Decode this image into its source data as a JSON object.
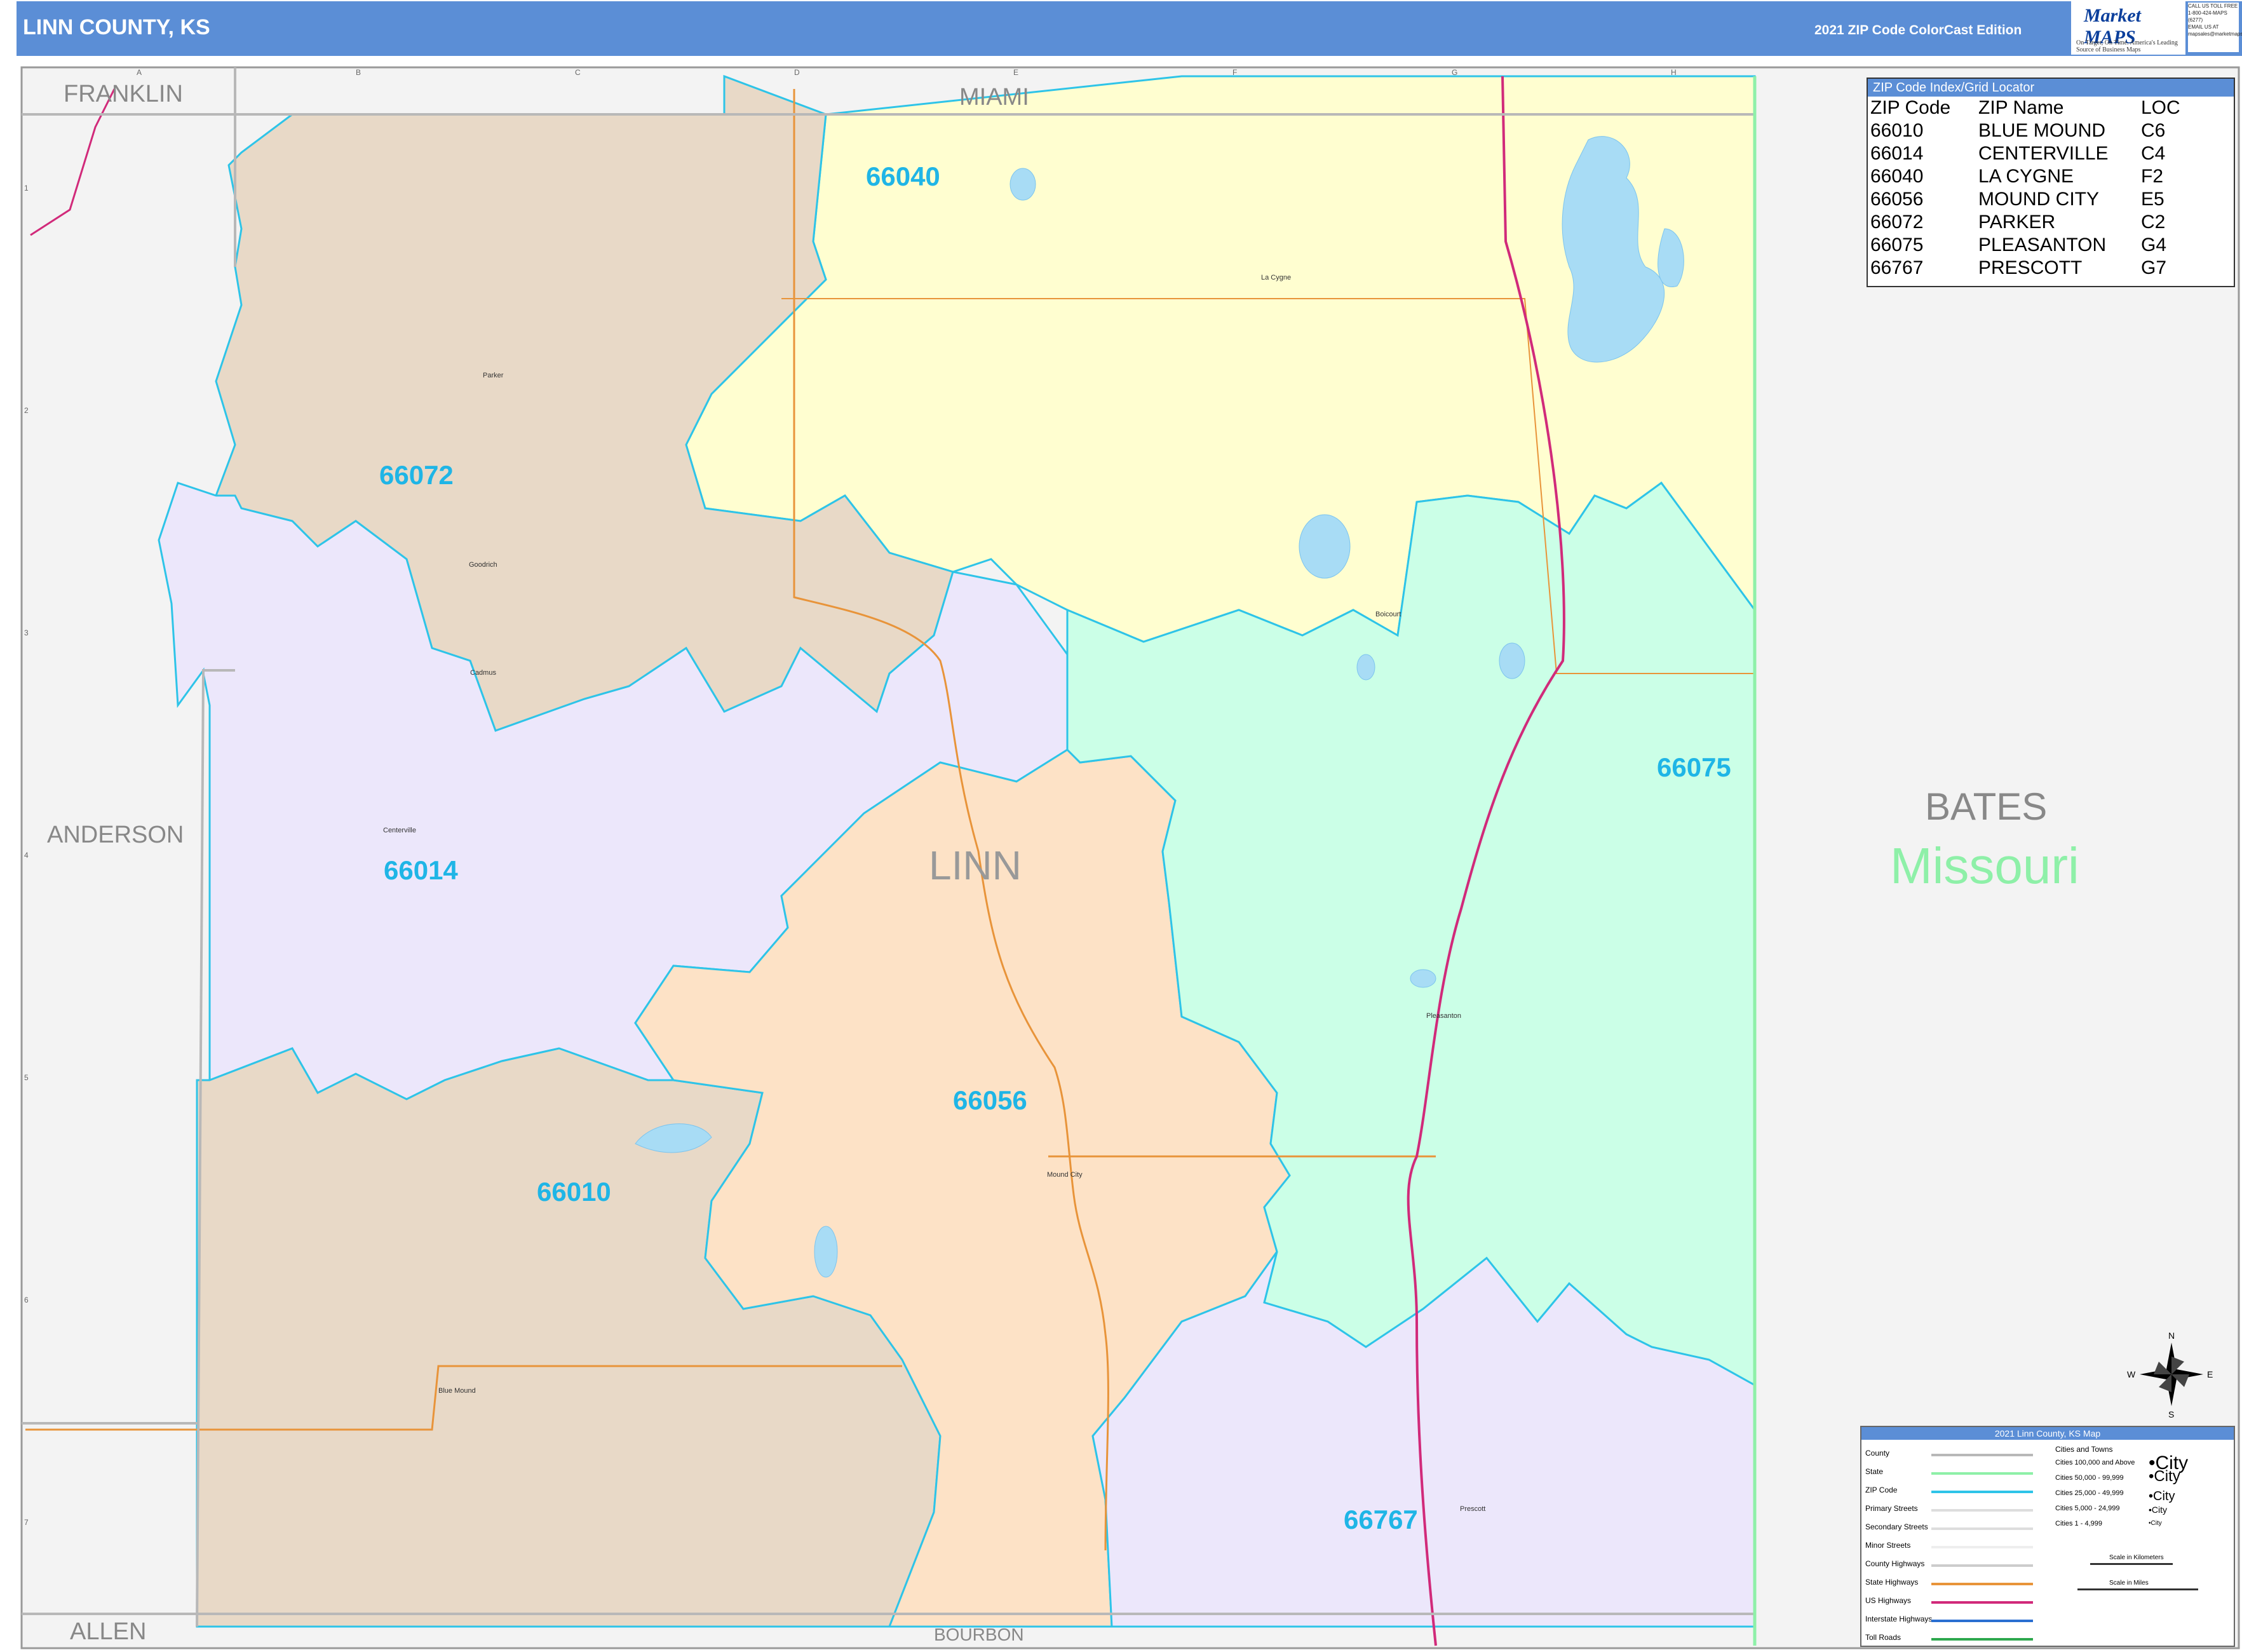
{
  "header": {
    "title": "LINN COUNTY, KS",
    "edition": "2021 ZIP Code ColorCast Edition",
    "logo_text": "Market MAPS",
    "logo_tagline": "On Target, On Time. America's Leading Source of Business Maps",
    "contact_lines": [
      "CALL US TOLL FREE",
      "1-800-424-MAPS (6277)",
      "EMAIL US AT",
      "mapsales@marketmaps.com"
    ]
  },
  "colors": {
    "header_bg": "#5b8ed6",
    "zip_label": "#1fb5e6",
    "zip_boundary": "#2ec4e8",
    "county_boundary": "#b8b8b8",
    "state_boundary": "#8ef0a8",
    "interstate": "#d12a7a",
    "state_highway": "#e8943a",
    "outside_fill": "#f3f3f3",
    "zone_66040": "#fffed0",
    "zone_66072_66010": "#e8d9c7",
    "zone_66014_66767": "#ece7fb",
    "zone_66056": "#fde2c6",
    "zone_66075": "#cbffe7"
  },
  "map": {
    "county_name": "LINN",
    "neighbor_counties": [
      "FRANKLIN",
      "MIAMI",
      "ANDERSON",
      "ALLEN",
      "BOURBON",
      "BATES"
    ],
    "neighbor_state": "Missouri",
    "grid_columns": [
      "A",
      "B",
      "C",
      "D",
      "E",
      "F",
      "G",
      "H"
    ],
    "grid_rows": [
      "1",
      "2",
      "3",
      "4",
      "5",
      "6",
      "7"
    ],
    "zip_labels": [
      "66040",
      "66072",
      "66014",
      "66075",
      "66056",
      "66010",
      "66767"
    ],
    "towns": [
      "La Cygne",
      "Parker",
      "Goodrich",
      "Cadmus",
      "Centerville",
      "Boicourt",
      "Pleasanton",
      "Mound City",
      "Blue Mound",
      "Prescott"
    ]
  },
  "zip_index": {
    "title": "ZIP Code Index/Grid Locator",
    "columns": [
      "ZIP Code",
      "ZIP Name",
      "LOC"
    ],
    "rows": [
      [
        "66010",
        "BLUE MOUND",
        "C6"
      ],
      [
        "66014",
        "CENTERVILLE",
        "C4"
      ],
      [
        "66040",
        "LA CYGNE",
        "F2"
      ],
      [
        "66056",
        "MOUND CITY",
        "E5"
      ],
      [
        "66072",
        "PARKER",
        "C2"
      ],
      [
        "66075",
        "PLEASANTON",
        "G4"
      ],
      [
        "66767",
        "PRESCOTT",
        "G7"
      ]
    ]
  },
  "map_legend": {
    "title": "2021 Linn County, KS Map",
    "items": [
      "County",
      "State",
      "ZIP Code",
      "Primary Streets",
      "Secondary Streets",
      "Minor Streets",
      "County Highways",
      "State Highways",
      "US Highways",
      "Interstate Highways",
      "Toll Roads"
    ],
    "cities_header": "Cities and Towns",
    "city_classes": [
      "Cities 100,000 and Above",
      "Cities 50,000 - 99,999",
      "Cities 25,000 - 49,999",
      "Cities 5,000 - 24,999",
      "Cities 1 - 4,999"
    ],
    "city_sample": "City",
    "scale_km": "Scale in Kilometers",
    "scale_mi": "Scale in Miles"
  },
  "compass": {
    "n": "N",
    "s": "S",
    "e": "E",
    "w": "W"
  }
}
